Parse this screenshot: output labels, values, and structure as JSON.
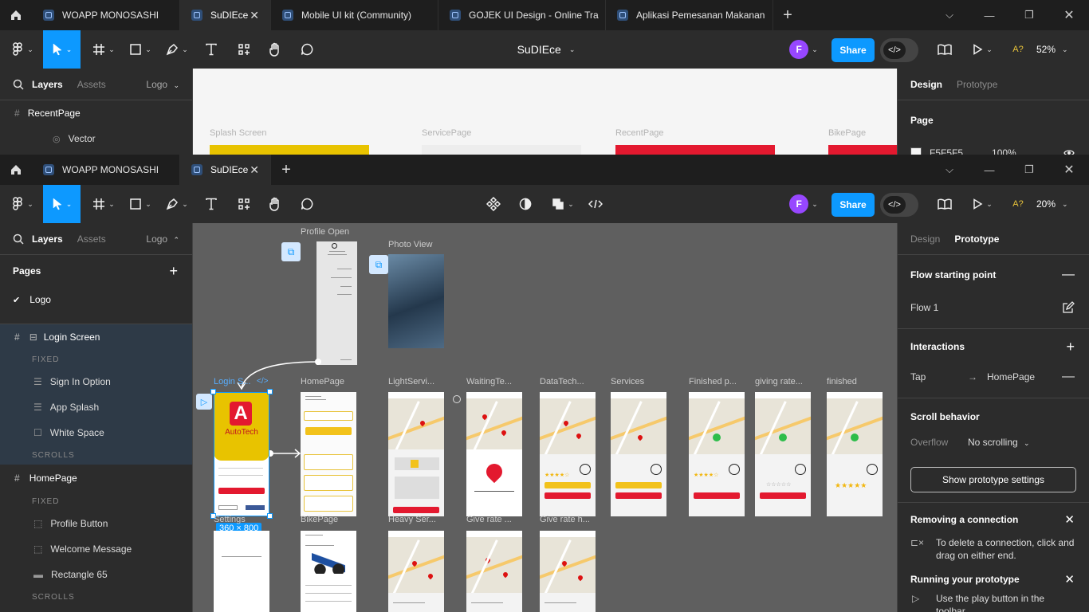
{
  "window1": {
    "tabs": [
      {
        "label": "WOAPP MONOSASHI",
        "active": false
      },
      {
        "label": "SuDIEce",
        "active": true
      },
      {
        "label": "Mobile UI kit (Community)",
        "active": false
      },
      {
        "label": "GOJEK UI Design - Online Tra",
        "active": false
      },
      {
        "label": "Aplikasi Pemesanan Makanan",
        "active": false
      }
    ],
    "file_title": "SuDIEce",
    "avatar": "F",
    "share": "Share",
    "zoom": "52%",
    "left_tabs": {
      "layers": "Layers",
      "assets": "Assets",
      "page": "Logo"
    },
    "layers": [
      {
        "label": "RecentPage"
      },
      {
        "label": "Vector"
      }
    ],
    "right_tabs": {
      "design": "Design",
      "prototype": "Prototype"
    },
    "page_section": {
      "title": "Page",
      "color": "F5F5F5",
      "opacity": "100%"
    },
    "canvas_labels": [
      "Splash Screen",
      "ServicePage",
      "RecentPage",
      "BikePage"
    ]
  },
  "window2": {
    "tabs": [
      {
        "label": "WOAPP MONOSASHI",
        "active": false
      },
      {
        "label": "SuDIEce",
        "active": true
      }
    ],
    "avatar": "F",
    "share": "Share",
    "zoom": "20%",
    "left_tabs": {
      "layers": "Layers",
      "assets": "Assets",
      "page": "Logo"
    },
    "pages_header": "Pages",
    "pages": [
      {
        "label": "Logo",
        "selected": true
      }
    ],
    "layers": {
      "login_screen": "Login Screen",
      "fixed": "FIXED",
      "scrolls": "SCROLLS",
      "login_children": [
        "Sign In Option",
        "App Splash",
        "White Space"
      ],
      "homepage": "HomePage",
      "homepage_children": [
        "Profile Button",
        "Welcome Message",
        "Rectangle 65"
      ]
    },
    "right_tabs": {
      "design": "Design",
      "prototype": "Prototype"
    },
    "prototype": {
      "flow_title": "Flow starting point",
      "flow_name": "Flow 1",
      "interactions_title": "Interactions",
      "trigger": "Tap",
      "destination": "HomePage",
      "scroll_title": "Scroll behavior",
      "overflow_label": "Overflow",
      "overflow_value": "No scrolling",
      "show_settings": "Show prototype settings",
      "tip1_title": "Removing a connection",
      "tip1_text": "To delete a connection, click and drag on either end.",
      "tip2_title": "Running your prototype",
      "tip2_text": "Use the play button in the toolbar"
    },
    "frames": {
      "profile_open": "Profile Open",
      "photo_view": "Photo View",
      "login": "Login S...",
      "homepage": "HomePage",
      "light_service": "LightServi...",
      "waiting": "WaitingTe...",
      "datatech": "DataTech...",
      "services": "Services",
      "finished_p": "Finished p...",
      "giving_rate": "giving rate...",
      "finished": "finished",
      "settings": "Settings",
      "bikepage": "BikePage",
      "heavy": "Heavy Ser...",
      "give_rate": "Give rate ...",
      "give_rate_h": "Give rate h..."
    },
    "selection_size": "360 × 800",
    "autotech_label": "AutoTech"
  },
  "colors": {
    "accent": "#0d99ff",
    "toolbar": "#2c2c2c",
    "tabbar": "#1e1e1e",
    "canvas": "#5f5f5f",
    "brand_red": "#e3192f",
    "brand_yellow": "#f2c21b"
  }
}
